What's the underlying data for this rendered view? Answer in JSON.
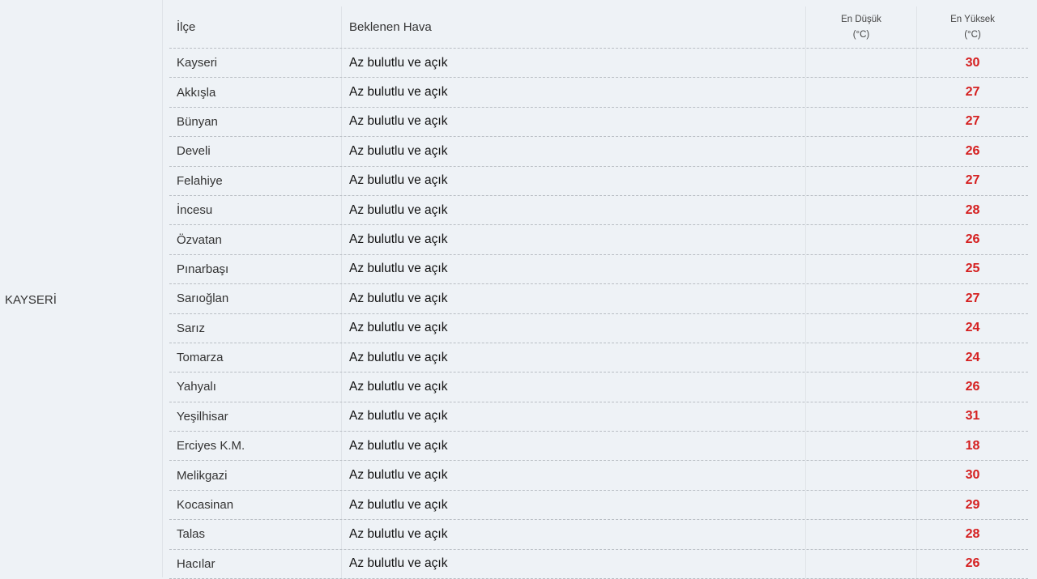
{
  "province": "KAYSERİ",
  "header": {
    "district": "İlçe",
    "weather": "Beklenen Hava",
    "min_line1": "En Düşük",
    "min_line2": "(°C)",
    "max_line1": "En Yüksek",
    "max_line2": "(°C)"
  },
  "rows": [
    {
      "district": "Kayseri",
      "weather": "Az bulutlu ve açık",
      "min": "",
      "max": "30"
    },
    {
      "district": "Akkışla",
      "weather": "Az bulutlu ve açık",
      "min": "",
      "max": "27"
    },
    {
      "district": "Bünyan",
      "weather": "Az bulutlu ve açık",
      "min": "",
      "max": "27"
    },
    {
      "district": "Develi",
      "weather": "Az bulutlu ve açık",
      "min": "",
      "max": "26"
    },
    {
      "district": "Felahiye",
      "weather": "Az bulutlu ve açık",
      "min": "",
      "max": "27"
    },
    {
      "district": "İncesu",
      "weather": "Az bulutlu ve açık",
      "min": "",
      "max": "28"
    },
    {
      "district": "Özvatan",
      "weather": "Az bulutlu ve açık",
      "min": "",
      "max": "26"
    },
    {
      "district": "Pınarbaşı",
      "weather": "Az bulutlu ve açık",
      "min": "",
      "max": "25"
    },
    {
      "district": "Sarıoğlan",
      "weather": "Az bulutlu ve açık",
      "min": "",
      "max": "27"
    },
    {
      "district": "Sarız",
      "weather": "Az bulutlu ve açık",
      "min": "",
      "max": "24"
    },
    {
      "district": "Tomarza",
      "weather": "Az bulutlu ve açık",
      "min": "",
      "max": "24"
    },
    {
      "district": "Yahyalı",
      "weather": "Az bulutlu ve açık",
      "min": "",
      "max": "26"
    },
    {
      "district": "Yeşilhisar",
      "weather": "Az bulutlu ve açık",
      "min": "",
      "max": "31"
    },
    {
      "district": "Erciyes K.M.",
      "weather": "Az bulutlu ve açık",
      "min": "",
      "max": "18"
    },
    {
      "district": "Melikgazi",
      "weather": "Az bulutlu ve açık",
      "min": "",
      "max": "30"
    },
    {
      "district": "Kocasinan",
      "weather": "Az bulutlu ve açık",
      "min": "",
      "max": "29"
    },
    {
      "district": "Talas",
      "weather": "Az bulutlu ve açık",
      "min": "",
      "max": "28"
    },
    {
      "district": "Hacılar",
      "weather": "Az bulutlu ve açık",
      "min": "",
      "max": "26"
    }
  ],
  "colors": {
    "background": "#eef2f6",
    "max_temp": "#d52020"
  }
}
